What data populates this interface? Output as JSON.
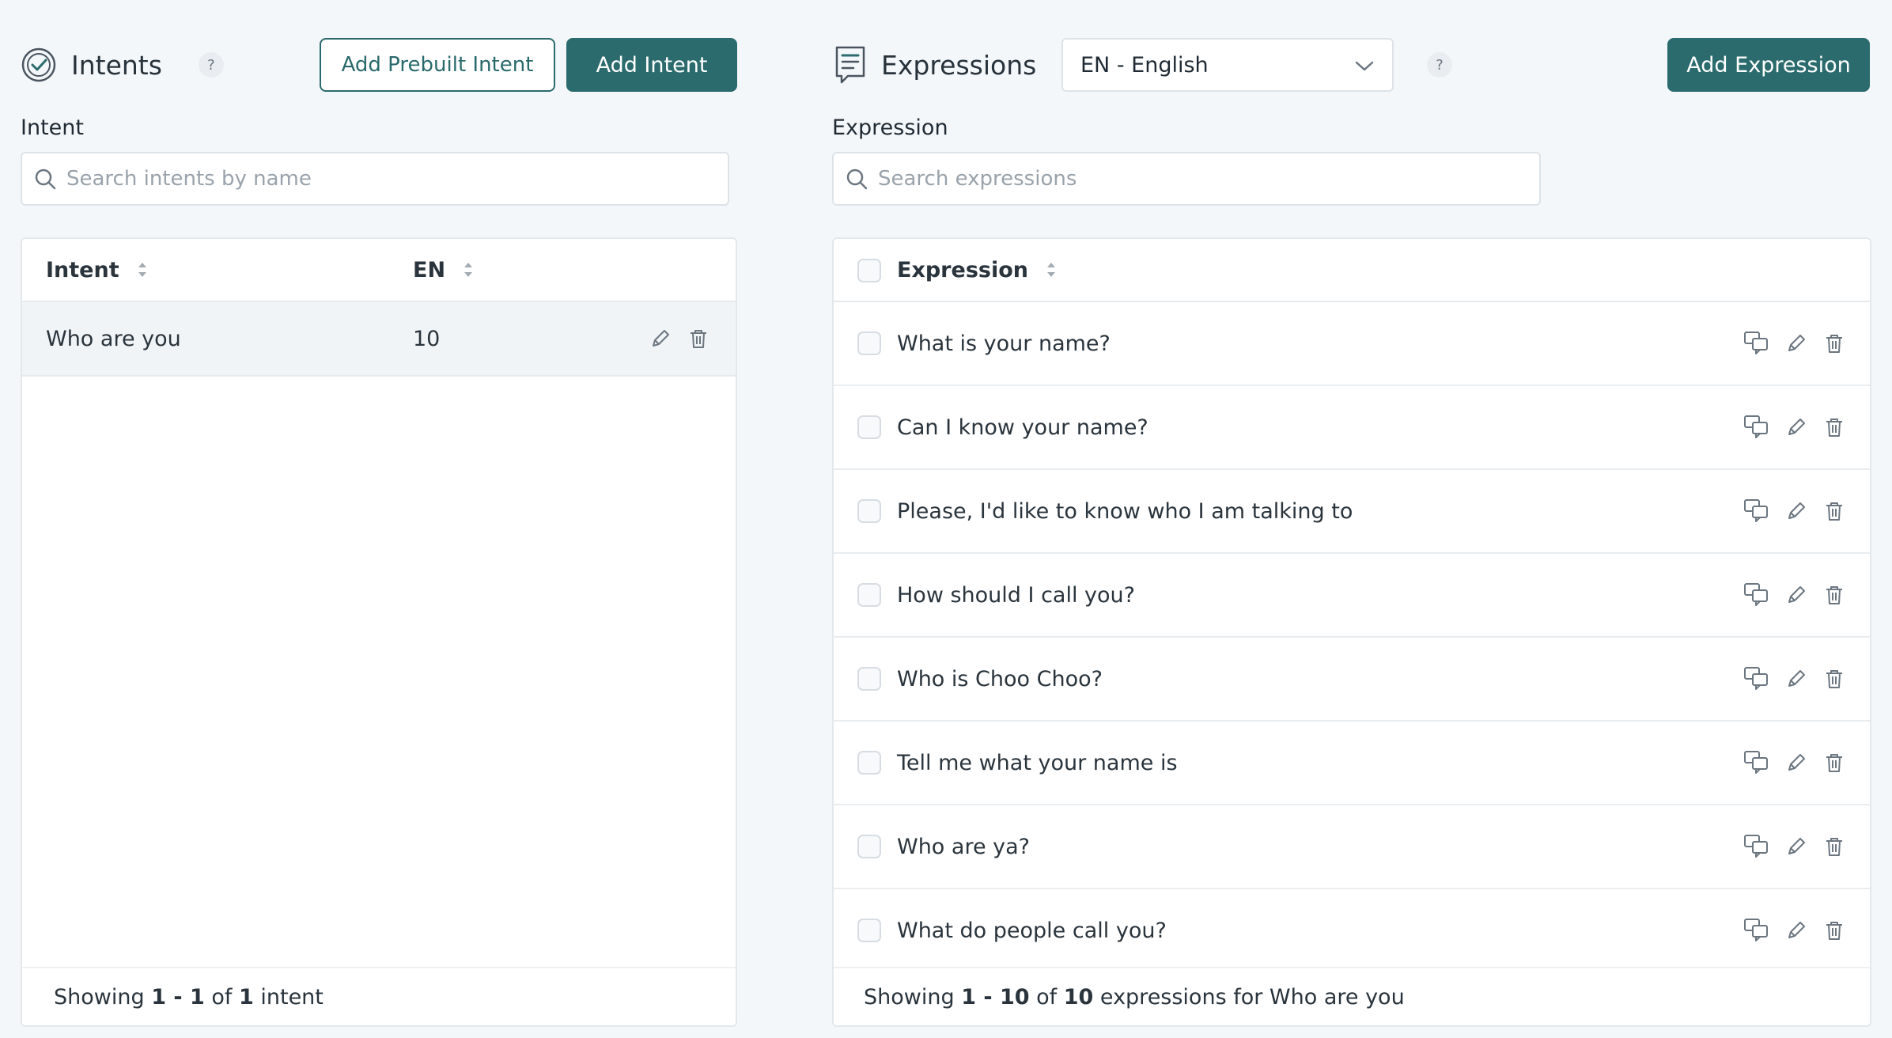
{
  "intents": {
    "title": "Intents",
    "help": "?",
    "add_prebuilt_label": "Add Prebuilt Intent",
    "add_intent_label": "Add Intent",
    "field_label": "Intent",
    "search_placeholder": "Search intents by name",
    "columns": {
      "intent": "Intent",
      "lang": "EN"
    },
    "rows": [
      {
        "name": "Who are you",
        "count": "10"
      }
    ],
    "footer": {
      "prefix": "Showing ",
      "range": "1 - 1",
      "of": " of ",
      "total": "1",
      "suffix": " intent"
    }
  },
  "expressions": {
    "title": "Expressions",
    "language": "EN - English",
    "help": "?",
    "add_label": "Add Expression",
    "field_label": "Expression",
    "search_placeholder": "Search expressions",
    "column": "Expression",
    "rows": [
      "What is your name?",
      "Can I know your name?",
      "Please, I'd like to know who I am talking to",
      "How should I call you?",
      "Who is Choo Choo?",
      "Tell me what your name is",
      "Who are ya?",
      "What do people call you?"
    ],
    "footer": {
      "prefix": "Showing ",
      "range": "1 - 10",
      "of": " of ",
      "total": "10",
      "suffix": " expressions for Who are you"
    }
  },
  "colors": {
    "accent": "#2b6b6d",
    "background": "#f4f7fa"
  },
  "icons": [
    "check-circle-icon",
    "document-list-icon",
    "search-icon",
    "sort-icon",
    "edit-icon",
    "trash-icon",
    "translate-icon",
    "chevron-down-icon"
  ]
}
